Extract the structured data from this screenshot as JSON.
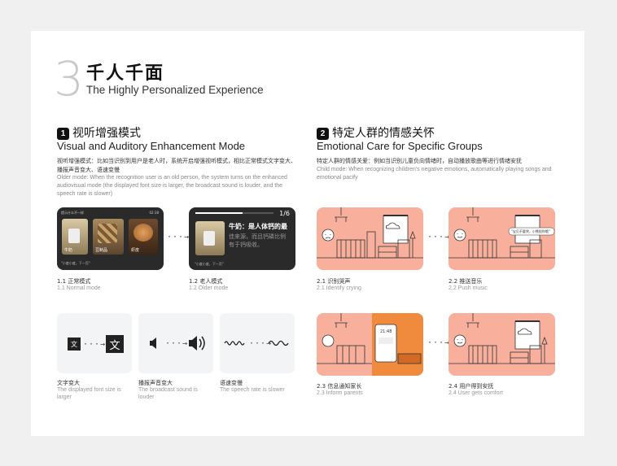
{
  "section": {
    "number": "3",
    "title_cn": "千人千面",
    "title_en": "The Highly Personalized Experience"
  },
  "left": {
    "badge": "1",
    "title_cn": "视听增强模式",
    "title_en": "Visual and Auditory Enhancement Mode",
    "desc_cn": "视听增强模式：比如当识别到用户是老人时，系统开启增强视听模式，相比正常模式文字变大、播报声音变大、语速变慢",
    "desc_en": "Older mode: When the recognition user is an old person, the system turns on the enhanced audiovisual mode (the displayed font size is larger, the broadcast sound is louder, and the speech rate is slower)",
    "normal": {
      "header": "提示什么不一样",
      "time": "02:38",
      "items": [
        "牛奶",
        "豆制品",
        "虾皮"
      ],
      "voice": "\"小度小度，下一页\"",
      "cap_cn": "1.1 正常模式",
      "cap_en": "1.1 Normal mode"
    },
    "older": {
      "page": "1/6",
      "title": "牛奶：是人体钙的最",
      "sub": "佳来源，而且钙磷比例有于钙吸收。",
      "voice": "\"小度小度，下一页\"",
      "cap_cn": "1.2 老人模式",
      "cap_en": "1.2 Older mode"
    },
    "features": [
      {
        "cn": "文字变大",
        "en": "The displayed font size is larger",
        "glyph": "文"
      },
      {
        "cn": "播报声音变大",
        "en": "The broadcast sound is louder"
      },
      {
        "cn": "语速变慢",
        "en": "The speech rate is slower"
      }
    ]
  },
  "right": {
    "badge": "2",
    "title_cn": "特定人群的情感关怀",
    "title_en": "Emotional Care for Specific Groups",
    "desc_cn": "特定人群的情感关爱：例如当识别儿童负向情绪时，自动播放歌曲等进行情绪安抚",
    "desc_en": "Child mode: When recognizing children's negative emotions, automatically playing songs and emotional pacify",
    "bubble": "\"宝贝不要哭，小熊陪你哦\"",
    "steps": [
      {
        "cn": "2.1 识别哭声",
        "en": "2.1 Identify crying"
      },
      {
        "cn": "2.2 推送音乐",
        "en": "2.2 Push music"
      },
      {
        "cn": "2.3 信息通知家长",
        "en": "2.3 Inform parents"
      },
      {
        "cn": "2.4 用户得到安抚",
        "en": "2.4 User gets comfort"
      }
    ],
    "phone_time": "21:48"
  },
  "arrow": "···→",
  "colors": {
    "pink": "#f8b09c",
    "orange": "#f08a3c",
    "dark": "#2a2a2a"
  }
}
